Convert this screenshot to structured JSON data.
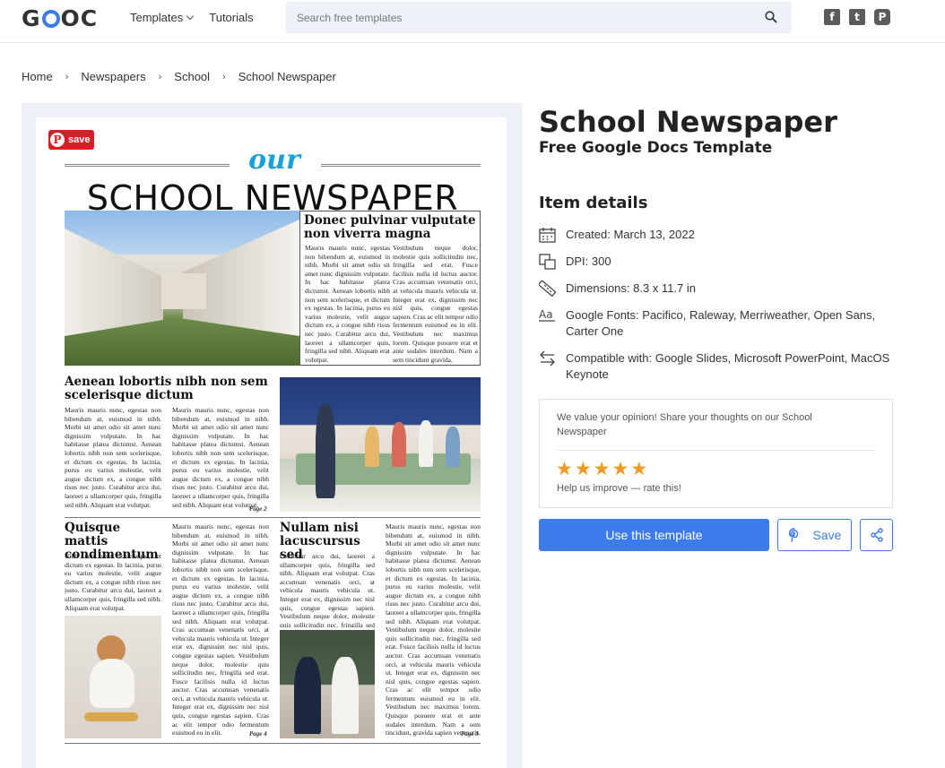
{
  "header": {
    "logo_left": "G",
    "logo_right": "C",
    "nav": [
      {
        "label": "Templates",
        "icon": "chevron-down-icon"
      },
      {
        "label": "Tutorials"
      }
    ],
    "search_placeholder": "Search free templates",
    "socials": [
      "facebook-icon",
      "twitter-icon",
      "pinterest-icon"
    ]
  },
  "breadcrumb": [
    "Home",
    "Newspapers",
    "School",
    "School Newspaper"
  ],
  "preview": {
    "pin_save_label": "save",
    "masthead_script": "our",
    "masthead_title": "SCHOOL NEWSPAPER",
    "headline_1": "Donec pulvinar vulputate non viverra magna",
    "headline_1_col_a": "Mauris mauris nunc, egestas non bibendum at, euismod in nibh. Morbi sit amet odio sit amet nunc dignissim vulputate. In hac habitasse platea dictumst. Aenean lobortis nibh non sem scelerisque, et dictum ex egestas. In lacinia, purus eu varius molestie, velit augue dictum ex, a congue nibh risus nec justo. Curabitur arcu dui, laoreet a ullamcorper quis, fringilla sed nibh. Aliquam erat volutpat.",
    "headline_1_col_b": "Vestibulum neque dolor, molestie quis sollicitudin nec, fringilla sed erat. Fusce facilisis nulla id luctus auctor. Cras accumsan venenatis orci, at vehicula mauris vehicula ut. Integer erat ex, dignissim nec nisl quis, congue egestas sapien. Cras ac elit tempor odio fermentum euismod eu in elit. Vestibulum nec maximus lorem. Quisque posuere erat et ante sodales interdum. Nam a sem tincidunt gravida.",
    "headline_2": "Aenean lobortis nibh non sem scelerisque dictum",
    "headline_2_col_a": "Mauris mauris nunc, egestas non bibendum at, euismod in nibh. Morbi sit amet odio sit amet nunc dignissim vulputate. In hac habitasse platea dictumst. Aenean lobortis nibh non sem scelerisque, et dictum ex egestas. In lacinia, purus eu varius molestie, velit augue dictum ex, a congue nibh risus nec justo. Curabitur arcu dui, laoreet a ullamcorper quis, fringilla sed nibh. Aliquam erat volutpat.",
    "headline_2_col_b": "Mauris mauris nunc, egestas non bibendum at, euismod in nibh. Morbi sit amet odio sit amet nunc dignissim vulputate. In hac habitasse platea dictumst. Aenean lobortis nibh non sem scelerisque, et dictum ex egestas. In lacinia, purus eu varius molestie, velit augue dictum ex, a congue nibh risus nec justo. Curabitur arcu dui, laoreet a ullamcorper quis, fringilla sed nibh. Aliquam erat volutpat.",
    "page_2": "Page 2",
    "headline_3": "Quisque mattis condimentum",
    "headline_3_col_a": "Nibh non sem scelerisque, et dictum ex egestas. In lacinia, purus eu varius molestie, velit augue dictum ex, a congue nibh risus nec justo. Curabitur arcu dui, laoreet a ullamcorper quis, fringilla sed nibh. Aliquam erat volutpat.",
    "headline_3_col_b": "Mauris mauris nunc, egestas non bibendum at, euismod in nibh. Morbi sit amet odio sit amet nunc dignissim vulputate. In hac habitasse platea dictumst. Aenean lobortis nibh non sem scelerisque, et dictum ex egestas. In lacinia, purus eu varius molestie, velit augue dictum ex, a congue nibh risus nec justo. Curabitur arcu dui, laoreet a ullamcorper quis, fringilla sed nibh. Aliquam erat volutpat. Cras accumsan venenatis orci, at vehicula mauris vehicula ut. Integer erat ex, dignissim nec nisl quis, congue egestas sapien. Vestibulum neque dolor, molestie quis sollicitudin nec, fringilla sed erat. Fusce facilisis nulla id luctus auctor. Cras accumsan venenatis orci, at vehicula mauris vehicula ut. Integer erat ex, dignissim nec nisl quis, congue egestas sapien. Cras ac elit tempor odio fermentum euismod eu in elit.",
    "page_4": "Page 4",
    "headline_4": "Nullam nisi lacuscursus sed",
    "headline_4_col_a": "Curabitur arcu dui, laoreet a ullamcorper quis, fringilla sed nibh. Aliquam erat volutpat. Cras accumsan venenatis orci, at vehicula mauris vehicula ut. Integer erat ex, dignissim nec nisl quis, congue egestas sapien. Vestibulum neque dolor, molestie quis sollicitudin nec, fringilla sed erat.",
    "headline_4_col_b": "Mauris mauris nunc, egestas non bibendum at, euismod in nibh. Morbi sit amet odio sit amet nunc dignissim vulputate. In hac habitasse platea dictumst. Aenean lobortis nibh non sem scelerisque, et dictum ex egestas. In lacinia, purus eu varius molestie, velit augue dictum ex, a congue nibh risus nec justo. Curabitur arcu dui, laoreet a ullamcorper quis, fringilla sed nibh. Aliquam erat volutpat. Vestibulum neque dolor, molestie quis sollicitudin nec, fringilla sed erat. Fusce facilisis nulla id luctus auctor. Cras accumsan venenatis orci, at vehicula mauris vehicula ut. Integer erat ex, dignissim nec nisl quis, congue egestas sapien. Cras ac elit tempor odio fermentum euismod eu in elit. Vestibulum nec maximus lorem. Quisque posuere erat et ante sodales interdum. Nam a sem tincidunt, gravida sapien venenatis, orci, at vehicula mauris.",
    "page_3": "Page 3"
  },
  "product": {
    "title": "School Newspaper",
    "subtitle": "Free Google Docs Template",
    "details_heading": "Item details",
    "details": [
      {
        "icon": "calendar-icon",
        "text": "Created: March 13, 2022"
      },
      {
        "icon": "dpi-icon",
        "text": "DPI: 300"
      },
      {
        "icon": "ruler-icon",
        "text": "Dimensions: 8.3 x 11.7 in"
      },
      {
        "icon": "font-icon",
        "text": "Google Fonts: Pacifico, Raleway, Merriweather, Open Sans, Carter One"
      },
      {
        "icon": "swap-arrows-icon",
        "text": "Compatible with: Google Slides, Microsoft PowerPoint, MacOS Keynote"
      }
    ],
    "feedback_prompt": "We value your opinion! Share your thoughts on our School Newspaper",
    "rating_stars": 5,
    "rating_help": "Help us improve — rate this!",
    "use_button": "Use this template",
    "save_button": "Save",
    "share_icon": "share-icon"
  },
  "colors": {
    "accent": "#3d7bea",
    "star": "#f39a1f",
    "pin_red": "#d51f26",
    "masthead_blue": "#1aa0d8"
  }
}
